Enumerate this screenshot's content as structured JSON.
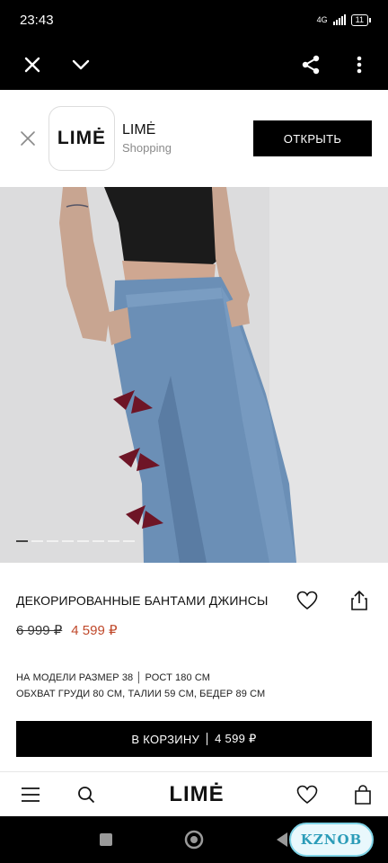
{
  "status_bar": {
    "time": "23:43",
    "network": "4G",
    "battery": "11"
  },
  "browser": {
    "icons": [
      "close-icon",
      "chevron-down-icon",
      "share-icon",
      "more-vert-icon"
    ]
  },
  "app_banner": {
    "logo": "LIMĖ",
    "app_name": "LIMĖ",
    "category": "Shopping",
    "open_label": "ОТКРЫТЬ"
  },
  "product": {
    "title": "ДЕКОРИРОВАННЫЕ БАНТАМИ ДЖИНСЫ",
    "old_price": "6 999 ₽",
    "sale_price": "4 599 ₽",
    "details_line1": "НА МОДЕЛИ РАЗМЕР 38 │ РОСТ 180 СМ",
    "details_line2": "ОБХВАТ ГРУДИ 80 СМ, ТАЛИИ 59 СМ, БЕДЕР 89 СМ",
    "carousel_count": 8,
    "carousel_active": 1
  },
  "cart_button": {
    "label": "В КОРЗИНУ",
    "price": "4 599 ₽"
  },
  "bottom_nav": {
    "logo": "LIMĖ"
  },
  "watermark": "KZNOB",
  "colors": {
    "sale": "#c0492b",
    "denim": "#5f86ad",
    "bow": "#6e1526"
  }
}
